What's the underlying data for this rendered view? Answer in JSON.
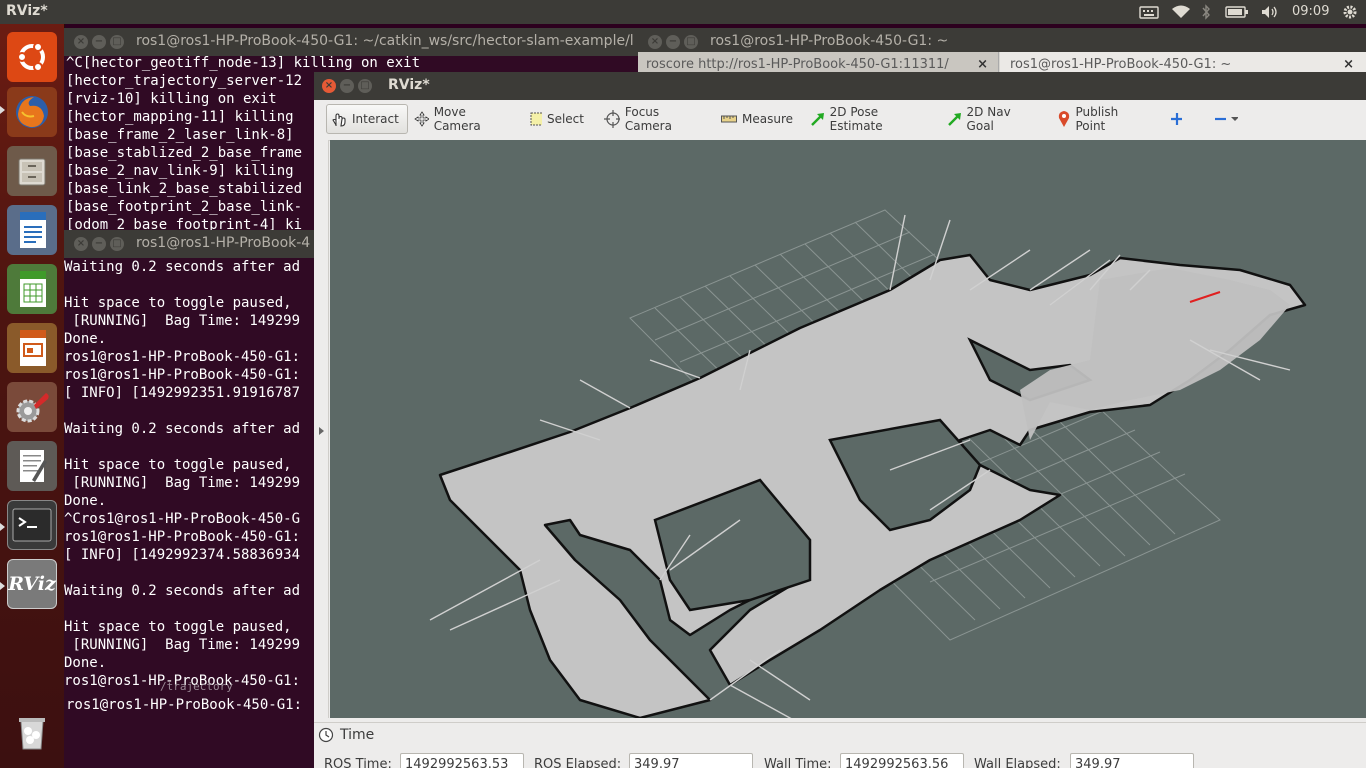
{
  "top_panel": {
    "app_title": "RViz*",
    "clock": "09:09",
    "indicators": [
      "keyboard-icon",
      "wifi-icon",
      "bluetooth-icon",
      "battery-icon",
      "volume-icon",
      "gear-icon"
    ]
  },
  "launcher": {
    "items": [
      {
        "name": "ubuntu-dash",
        "icon": "ubuntu-logo-icon"
      },
      {
        "name": "firefox",
        "icon": "firefox-icon"
      },
      {
        "name": "files",
        "icon": "file-cabinet-icon"
      },
      {
        "name": "writer",
        "icon": "writer-doc-icon"
      },
      {
        "name": "calc",
        "icon": "calc-sheet-icon"
      },
      {
        "name": "impress",
        "icon": "impress-slide-icon"
      },
      {
        "name": "settings",
        "icon": "wrench-gear-icon"
      },
      {
        "name": "text-editor",
        "icon": "text-editor-icon"
      },
      {
        "name": "terminal",
        "icon": "terminal-icon"
      },
      {
        "name": "rviz",
        "icon": "rviz-icon",
        "label": "RViz"
      },
      {
        "name": "trash",
        "icon": "trash-icon"
      }
    ]
  },
  "term_back": {
    "title": "ros1@ros1-HP-ProBook-450-G1: ~/catkin_ws/src/hector-slam-example/l",
    "lines": [
      "^C[hector_geotiff_node-13] killing on exit",
      "[hector_trajectory_server-12",
      "[rviz-10] killing on exit",
      "[hector_mapping-11] killing",
      "[base_frame_2_laser_link-8]",
      "[base_stablized_2_base_frame",
      "[base_2_nav_link-9] killing",
      "[base_link_2_base_stabilized",
      "[base_footprint_2_base_link-",
      "[odom_2_base_footprint-4] ki"
    ]
  },
  "term_right": {
    "title": "ros1@ros1-HP-ProBook-450-G1: ~",
    "tabs": [
      {
        "label": "roscore http://ros1-HP-ProBook-450-G1:11311/"
      },
      {
        "label": "ros1@ros1-HP-ProBook-450-G1: ~"
      }
    ]
  },
  "term_front": {
    "title": "ros1@ros1-HP-ProBook-4",
    "lines": [
      "Waiting 0.2 seconds after ad",
      "",
      "Hit space to toggle paused,",
      " [RUNNING]  Bag Time: 149299",
      "Done.",
      "ros1@ros1-HP-ProBook-450-G1:",
      "ros1@ros1-HP-ProBook-450-G1:",
      "[ INFO] [1492992351.91916787",
      "",
      "Waiting 0.2 seconds after ad",
      "",
      "Hit space to toggle paused,",
      " [RUNNING]  Bag Time: 149299",
      "Done.",
      "^Cros1@ros1-HP-ProBook-450-G",
      "ros1@ros1-HP-ProBook-450-G1:",
      "[ INFO] [1492992374.58836934",
      "",
      "Waiting 0.2 seconds after ad",
      "",
      "Hit space to toggle paused,",
      " [RUNNING]  Bag Time: 149299",
      "Done.",
      "ros1@ros1-HP-ProBook-450-G1:"
    ],
    "trajectory_fragment": "/trajectory",
    "prompt_line": "ros1@ros1-HP-ProBook-450-G1:"
  },
  "rviz": {
    "title": "RViz*",
    "toolbar": {
      "interact": "Interact",
      "move_camera": "Move Camera",
      "select": "Select",
      "focus_camera": "Focus Camera",
      "measure": "Measure",
      "pose_estimate": "2D Pose Estimate",
      "nav_goal": "2D Nav Goal",
      "publish_point": "Publish Point"
    },
    "time_panel": {
      "header": "Time",
      "ros_time_label": "ROS Time:",
      "ros_time": "1492992563.53",
      "ros_elapsed_label": "ROS Elapsed:",
      "ros_elapsed": "349.97",
      "wall_time_label": "Wall Time:",
      "wall_time": "1492992563.56",
      "wall_elapsed_label": "Wall Elapsed:",
      "wall_elapsed": "349.97"
    },
    "colors": {
      "viewport_bg": "#5c6966",
      "map_free": "#c4c4c4",
      "map_wall": "#111111",
      "grid": "#a0a8a6",
      "robot_pose": "#e02020"
    }
  }
}
